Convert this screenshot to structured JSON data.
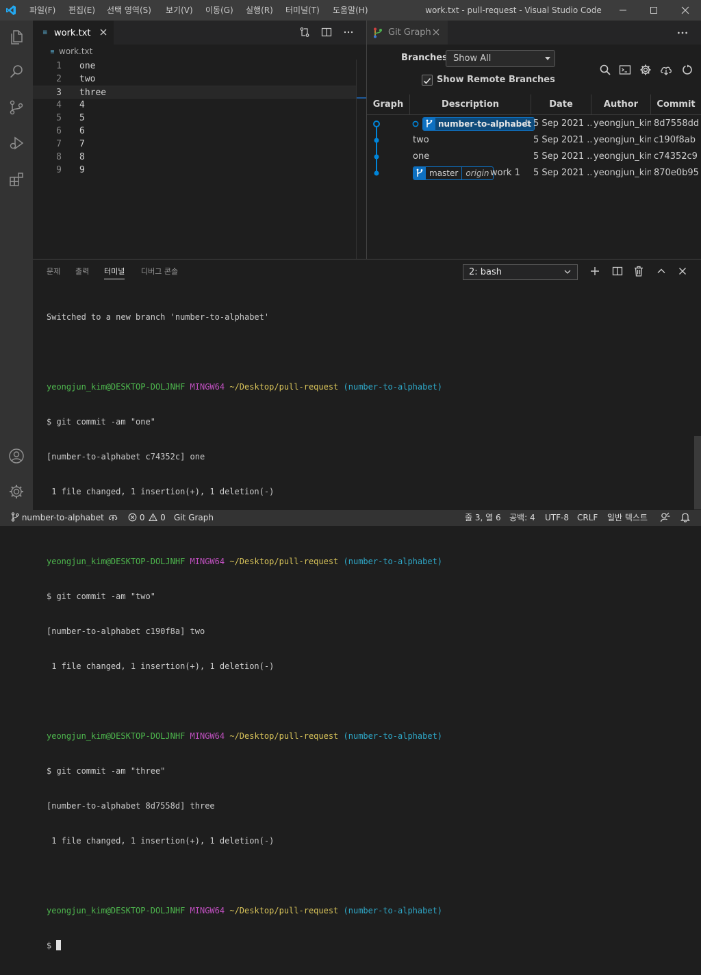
{
  "app": {
    "window_title": "work.txt - pull-request - Visual Studio Code",
    "menu": [
      "파일(F)",
      "편집(E)",
      "선택 영역(S)",
      "보기(V)",
      "이동(G)",
      "실행(R)",
      "터미널(T)",
      "도움말(H)"
    ]
  },
  "editor": {
    "tab_label": "work.txt",
    "breadcrumb": "work.txt",
    "lines": [
      {
        "num": "1",
        "text": "one"
      },
      {
        "num": "2",
        "text": "two"
      },
      {
        "num": "3",
        "text": "three"
      },
      {
        "num": "4",
        "text": "4"
      },
      {
        "num": "5",
        "text": "5"
      },
      {
        "num": "6",
        "text": "6"
      },
      {
        "num": "7",
        "text": "7"
      },
      {
        "num": "8",
        "text": "8"
      },
      {
        "num": "9",
        "text": "9"
      }
    ]
  },
  "git_graph": {
    "tab_label": "Git Graph",
    "branches_label": "Branches:",
    "branches_value": "Show All",
    "show_remote_label": "Show Remote Branches",
    "show_remote_checked": true,
    "columns": [
      "Graph",
      "Description",
      "Date",
      "Author",
      "Commit"
    ],
    "rows": [
      {
        "description": "",
        "branch": "number-to-alphabet",
        "trail": "t",
        "date": "5 Sep 2021 ...",
        "author": "yeongjun_kim",
        "commit": "8d7558dd"
      },
      {
        "description": "two",
        "date": "5 Sep 2021 ...",
        "author": "yeongjun_kim",
        "commit": "c190f8ab"
      },
      {
        "description": "one",
        "date": "5 Sep 2021 ...",
        "author": "yeongjun_kim",
        "commit": "c74352c9"
      },
      {
        "description": "work 1",
        "branch": "master",
        "remote": "origin",
        "date": "5 Sep 2021 ...",
        "author": "yeongjun_kim",
        "commit": "870e0b95"
      }
    ],
    "colors": {
      "branch": "#0e70c0",
      "graph_line": "#0085d9"
    }
  },
  "panel": {
    "tabs": [
      "문제",
      "출력",
      "터미널",
      "디버그 콘솔"
    ],
    "active_tab": "터미널",
    "terminal_select": "2: bash",
    "prompt": {
      "user": "yeongjun_kim@DESKTOP-DOLJNHF",
      "env": "MINGW64",
      "path": "~/Desktop/pull-request",
      "branch": "(number-to-alphabet)"
    },
    "lines": [
      "Switched to a new branch 'number-to-alphabet'",
      "$ git commit -am \"one\"",
      "[number-to-alphabet c74352c] one",
      " 1 file changed, 1 insertion(+), 1 deletion(-)",
      "$ git commit -am \"two\"",
      "[number-to-alphabet c190f8a] two",
      " 1 file changed, 1 insertion(+), 1 deletion(-)",
      "$ git commit -am \"three\"",
      "[number-to-alphabet 8d7558d] three",
      " 1 file changed, 1 insertion(+), 1 deletion(-)",
      "$ "
    ]
  },
  "status": {
    "branch": "number-to-alphabet",
    "errors": "0",
    "warnings": "0",
    "git_graph": "Git Graph",
    "position": "줄 3, 열 6",
    "spaces": "공백: 4",
    "encoding": "UTF-8",
    "eol": "CRLF",
    "language": "일반 텍스트"
  }
}
